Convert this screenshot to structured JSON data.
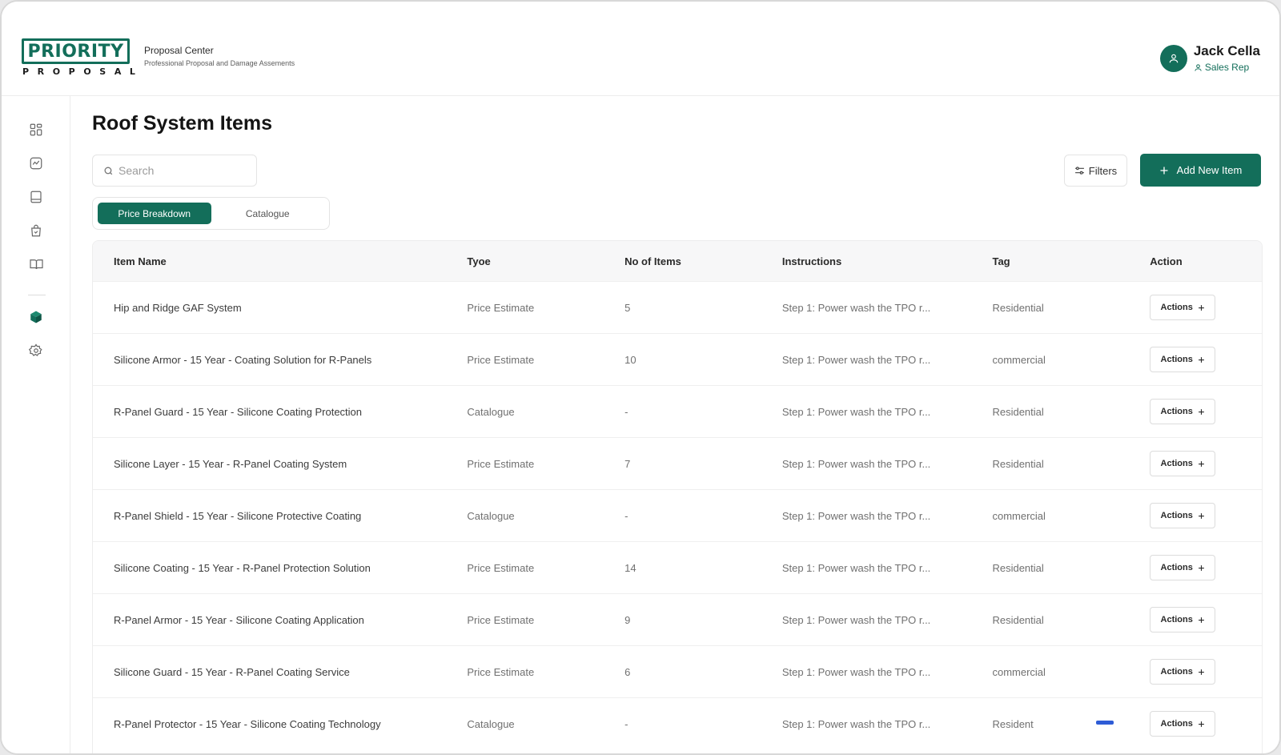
{
  "brand": {
    "logo_top": "PRIORITY",
    "logo_bottom": "PROPOSAL",
    "color": "#136e5a"
  },
  "app": {
    "title": "Proposal Center",
    "subtitle": "Professional Proposal and Damage Assements"
  },
  "user": {
    "name": "Jack Cella",
    "role": "Sales Rep",
    "avatar_icon": "user-icon"
  },
  "sidebar": {
    "items": [
      {
        "name": "dashboard",
        "icon": "grid-icon",
        "active": false
      },
      {
        "name": "analytics",
        "icon": "activity-chart-icon",
        "active": false
      },
      {
        "name": "documents",
        "icon": "document-icon",
        "active": false
      },
      {
        "name": "orders",
        "icon": "shopping-bag-icon",
        "active": false
      },
      {
        "name": "catalogue",
        "icon": "book-icon",
        "active": false
      },
      {
        "name": "items",
        "icon": "box-icon",
        "active": true
      },
      {
        "name": "settings",
        "icon": "gear-icon",
        "active": false
      }
    ]
  },
  "page": {
    "title": "Roof System Items"
  },
  "search": {
    "placeholder": "Search",
    "value": ""
  },
  "toolbar": {
    "filters_label": "Filters",
    "add_label": "Add New Item"
  },
  "tabs": [
    {
      "label": "Price Breakdown",
      "active": true
    },
    {
      "label": "Catalogue",
      "active": false
    }
  ],
  "table": {
    "columns": [
      "Item Name",
      "Tyoe",
      "No of Items",
      "Instructions",
      "Tag",
      "Action"
    ],
    "action_label": "Actions",
    "rows": [
      {
        "name": "Hip and Ridge GAF System",
        "type": "Price Estimate",
        "count": "5",
        "instructions": "Step 1: Power wash the TPO r...",
        "tag": "Residential"
      },
      {
        "name": "Silicone Armor - 15 Year - Coating Solution for R-Panels",
        "type": "Price Estimate",
        "count": "10",
        "instructions": "Step 1: Power wash the TPO r...",
        "tag": "commercial"
      },
      {
        "name": "R-Panel Guard - 15 Year - Silicone Coating Protection",
        "type": "Catalogue",
        "count": "-",
        "instructions": "Step 1: Power wash the TPO r...",
        "tag": "Residential"
      },
      {
        "name": "Silicone Layer - 15 Year - R-Panel Coating System",
        "type": "Price Estimate",
        "count": "7",
        "instructions": "Step 1: Power wash the TPO r...",
        "tag": "Residential"
      },
      {
        "name": "R-Panel Shield - 15 Year - Silicone Protective Coating",
        "type": "Catalogue",
        "count": "-",
        "instructions": "Step 1: Power wash the TPO r...",
        "tag": "commercial"
      },
      {
        "name": "Silicone Coating - 15 Year - R-Panel Protection Solution",
        "type": "Price Estimate",
        "count": "14",
        "instructions": "Step 1: Power wash the TPO r...",
        "tag": "Residential"
      },
      {
        "name": "R-Panel Armor - 15 Year - Silicone Coating Application",
        "type": "Price Estimate",
        "count": "9",
        "instructions": "Step 1: Power wash the TPO r...",
        "tag": "Residential"
      },
      {
        "name": "Silicone Guard - 15 Year - R-Panel Coating Service",
        "type": "Price Estimate",
        "count": "6",
        "instructions": "Step 1: Power wash the TPO r...",
        "tag": "commercial"
      },
      {
        "name": "R-Panel Protector - 15 Year - Silicone Coating Technology",
        "type": "Catalogue",
        "count": "-",
        "instructions": "Step 1: Power wash the TPO r...",
        "tag": "Resident"
      }
    ]
  }
}
